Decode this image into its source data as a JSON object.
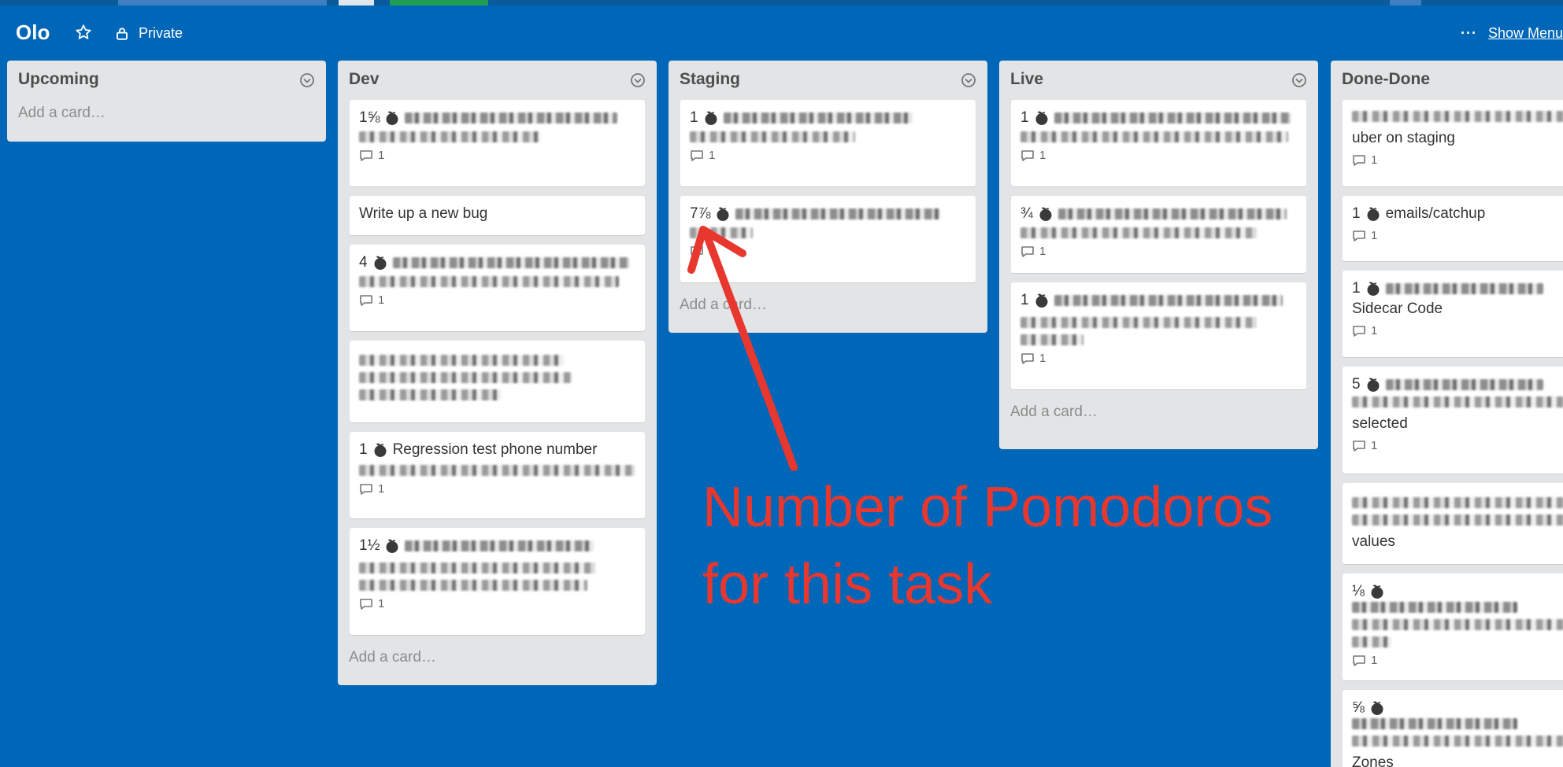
{
  "board": {
    "title": "Olo",
    "visibility": "Private",
    "show_menu_dots": "···",
    "show_menu_label": "Show Menu"
  },
  "colors": {
    "board_bg": "#0067b8",
    "list_bg": "#e2e4e6",
    "annotation": "#e8372f"
  },
  "lists": [
    {
      "title": "Upcoming",
      "add_card": "Add a card…"
    },
    {
      "title": "Dev",
      "add_card": "Add a card…",
      "cards": [
        {
          "pomodoros": "1⅝",
          "title": "",
          "comments": "1"
        },
        {
          "pomodoros": "",
          "title": "Write up a new bug",
          "comments": ""
        },
        {
          "pomodoros": "4",
          "title": "",
          "comments": "1"
        },
        {
          "pomodoros": "",
          "title": "",
          "comments": ""
        },
        {
          "pomodoros": "1",
          "title": "Regression test phone number",
          "comments": "1"
        },
        {
          "pomodoros": "1½",
          "title": "",
          "comments": "1"
        }
      ]
    },
    {
      "title": "Staging",
      "add_card": "Add a card…",
      "cards": [
        {
          "pomodoros": "1",
          "title": "",
          "comments": "1"
        },
        {
          "pomodoros": "7⅞",
          "title": "",
          "comments": "1"
        }
      ]
    },
    {
      "title": "Live",
      "add_card": "Add a card…",
      "cards": [
        {
          "pomodoros": "1",
          "title": "",
          "comments": "1"
        },
        {
          "pomodoros": "¾",
          "title": "",
          "comments": "1"
        },
        {
          "pomodoros": "1",
          "title": "",
          "comments": "1"
        }
      ]
    },
    {
      "title": "Done-Done",
      "cards": [
        {
          "pomodoros": "",
          "title": "uber on staging",
          "comments": "1"
        },
        {
          "pomodoros": "1",
          "title": "emails/catchup",
          "comments": "1"
        },
        {
          "pomodoros": "1",
          "title": "Sidecar Code",
          "comments": "1"
        },
        {
          "pomodoros": "5",
          "title": "selected",
          "comments": "1"
        },
        {
          "pomodoros": "",
          "title": "values",
          "comments": ""
        },
        {
          "pomodoros": "⅛",
          "title": "",
          "comments": "1"
        },
        {
          "pomodoros": "⅝",
          "title": "Zones",
          "comments": ""
        }
      ]
    }
  ],
  "annotation": {
    "line1": "Number of Pomodoros",
    "line2": "for this task"
  }
}
